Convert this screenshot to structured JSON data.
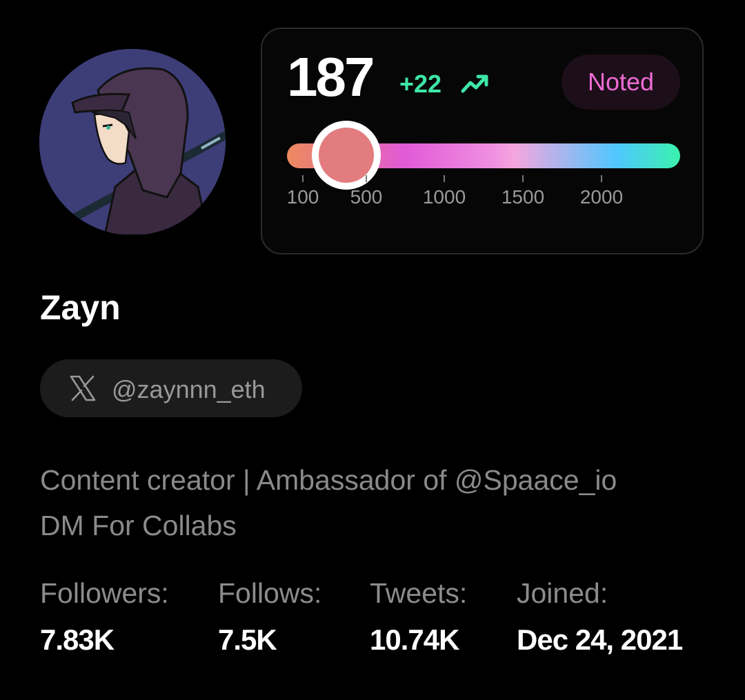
{
  "profile": {
    "avatar_icon": "anime-hooded-character-avatar",
    "name": "Zayn",
    "handle": "@zaynnn_eth",
    "handle_icon": "x-logo-icon",
    "bio_line1": "Content creator | Ambassador of @Spaace_io",
    "bio_line2": "DM For Collabs"
  },
  "score": {
    "value": "187",
    "change": "+22",
    "change_icon": "trending-up-icon",
    "badge": "Noted",
    "slider_value": 187,
    "ticks": [
      "100",
      "500",
      "1000",
      "1500",
      "2000"
    ]
  },
  "stats": [
    {
      "label": "Followers:",
      "value": "7.83K"
    },
    {
      "label": "Follows:",
      "value": "7.5K"
    },
    {
      "label": "Tweets:",
      "value": "10.74K"
    },
    {
      "label": "Joined:",
      "value": "Dec 24, 2021"
    }
  ],
  "colors": {
    "background": "#000000",
    "accent_green": "#3ee6a6",
    "badge_text": "#ee6bd4",
    "thumb": "#e27c7e"
  }
}
